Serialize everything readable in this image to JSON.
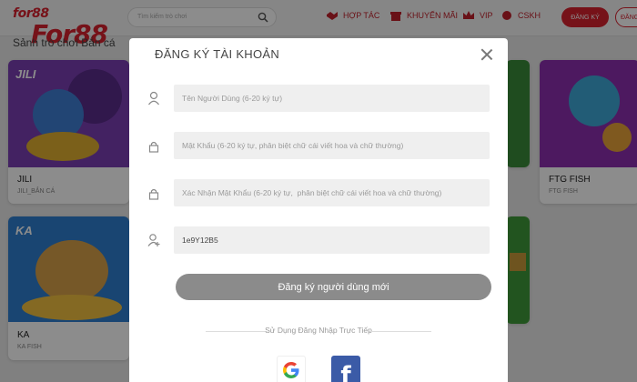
{
  "logo": {
    "small": "for88",
    "big": "For88"
  },
  "search": {
    "placeholder": "Tìm kiếm trò chơi"
  },
  "nav": {
    "hop_tac": "HỢP TÁC",
    "khuyen_mai": "KHUYẾN MÃI",
    "vip": "VIP",
    "cskh": "CSKH",
    "dang_ky": "ĐĂNG KÝ",
    "dang_nhap": "ĐĂNG"
  },
  "lobby": {
    "title": "Sảnh trò chơi Bắn cá",
    "cards": [
      {
        "brand": "JILI",
        "name": "JILI",
        "sub": "JILI_BẮN CÁ"
      },
      {
        "brand": "",
        "name": "FTG FISH",
        "sub": "FTG FISH"
      },
      {
        "brand": "KA",
        "name": "KA",
        "sub": "KA FISH"
      }
    ]
  },
  "modal": {
    "title": "ĐĂNG KÝ TÀI KHOẢN",
    "username_placeholder": "Tên Người Dùng (6-20 ký tự)",
    "password_placeholder": "Mật Khẩu (6-20 ký tự, phân biệt chữ cái viết hoa và chữ thường)",
    "confirm_placeholder": "Xác Nhận Mật Khẩu (6-20 ký tự,  phân biệt chữ cái viết hoa và chữ thường)",
    "referral_value": "1e9Y12B5",
    "submit_label": "Đăng ký người dùng mới",
    "direct_login": "Sử Dụng Đăng Nhập Trực Tiếp",
    "facebook_glyph": "f"
  },
  "colors": {
    "brand_red": "#d8212f",
    "submit_gray": "#8b8b8b",
    "facebook_blue": "#3b5ba7"
  }
}
